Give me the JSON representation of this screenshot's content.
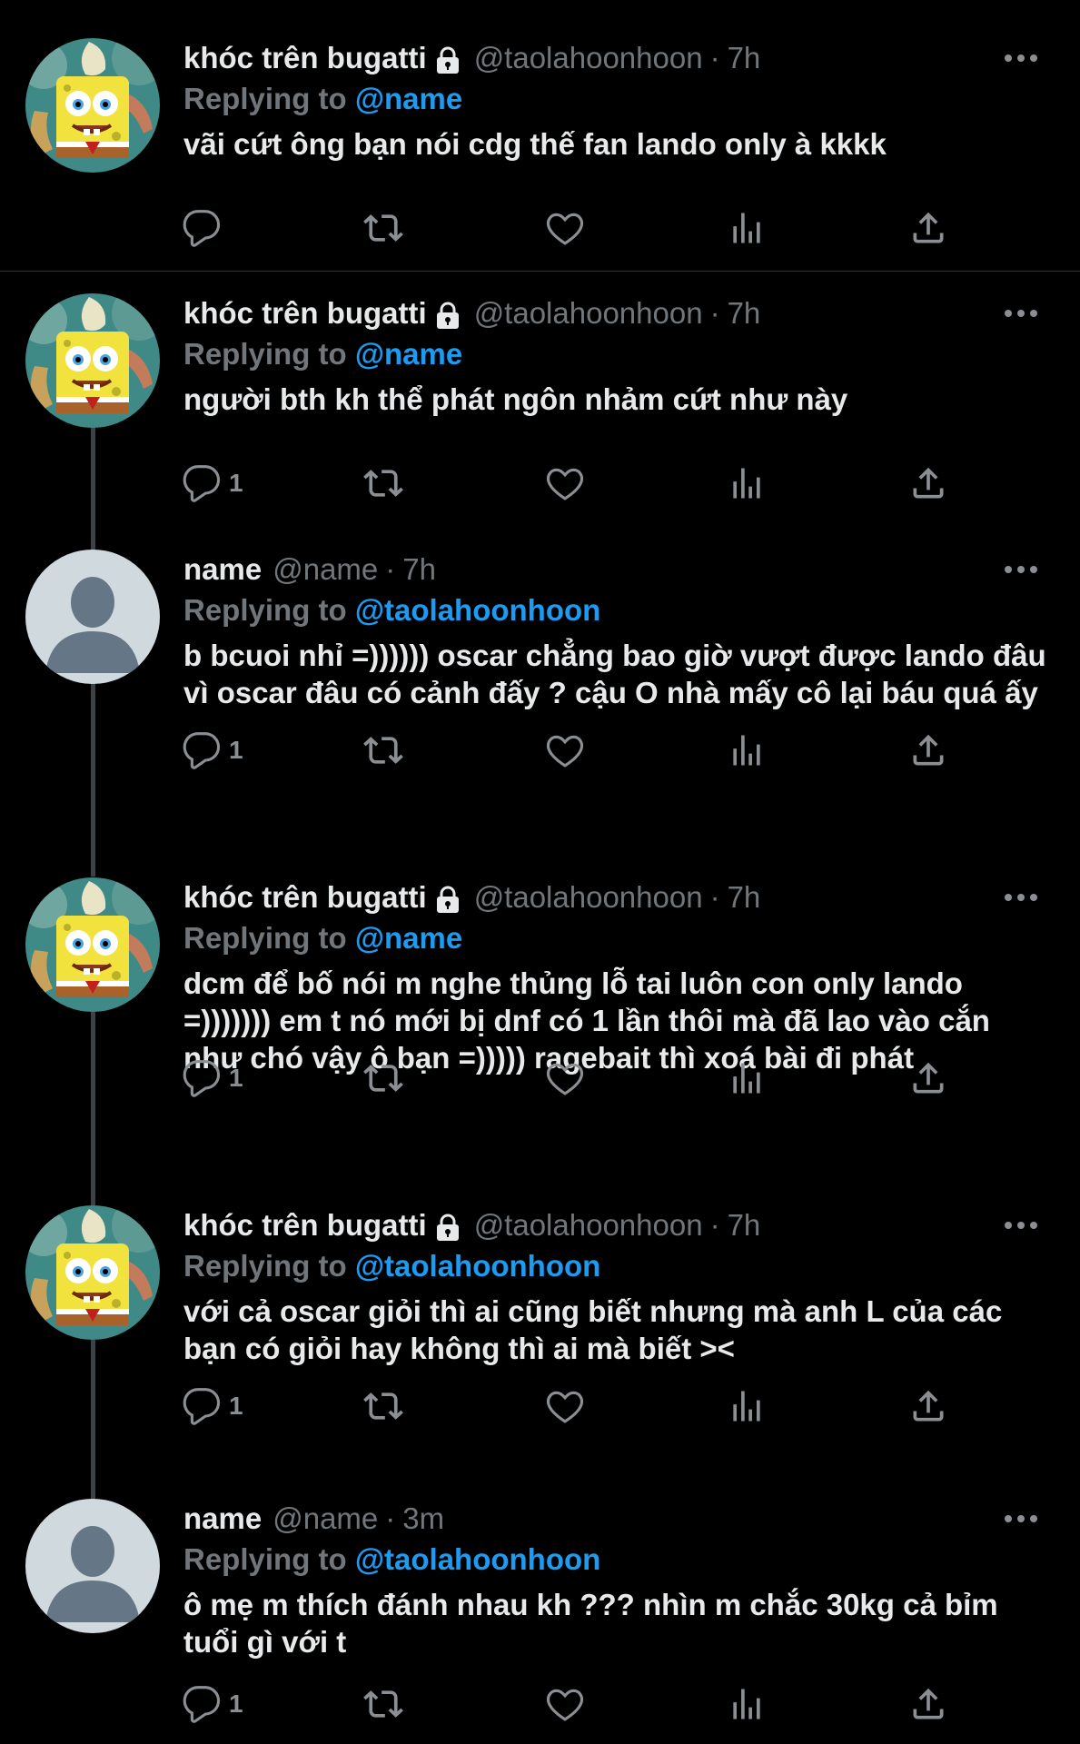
{
  "colors": {
    "background": "#000000",
    "text": "#e7e9ea",
    "muted": "#71767b",
    "mention": "#1d9bf0"
  },
  "replying_label": "Replying to",
  "tweets": [
    {
      "author": "khóc trên bugatti",
      "locked": true,
      "avatar": "spongebob-avatar",
      "handle": "@taolahoonhoon",
      "sep": "·",
      "time": "7h",
      "reply_to": "@name",
      "text": "vãi cứt ông bạn nói cdg thế fan lando only à kkkk",
      "reply_count": ""
    },
    {
      "author": "khóc trên bugatti",
      "locked": true,
      "avatar": "spongebob-avatar",
      "handle": "@taolahoonhoon",
      "sep": "·",
      "time": "7h",
      "reply_to": "@name",
      "text": "người bth kh thể phát ngôn nhảm cứt như này",
      "reply_count": "1"
    },
    {
      "author": "name",
      "locked": false,
      "avatar": "default-avatar",
      "handle": "@name",
      "sep": "·",
      "time": "7h",
      "reply_to": "@taolahoonhoon",
      "text": "b bcuoi nhỉ =)))))) oscar chẳng bao giờ vượt được lando đâu vì oscar đâu có cảnh đấy ? cậu O nhà mấy cô lại báu quá ấy",
      "reply_count": "1"
    },
    {
      "author": "khóc trên bugatti",
      "locked": true,
      "avatar": "spongebob-avatar",
      "handle": "@taolahoonhoon",
      "sep": "·",
      "time": "7h",
      "reply_to": "@name",
      "text": "dcm để bố nói m nghe thủng lỗ tai luôn con only lando =))))))) em t nó mới bị dnf có 1 lần thôi mà đã lao vào cắn như chó vậy ô bạn =))))) ragebait thì xoá bài đi phát",
      "reply_count": "1"
    },
    {
      "author": "khóc trên bugatti",
      "locked": true,
      "avatar": "spongebob-avatar",
      "handle": "@taolahoonhoon",
      "sep": "·",
      "time": "7h",
      "reply_to": "@taolahoonhoon",
      "text": "với cả oscar giỏi thì ai cũng biết nhưng mà anh L của các bạn có giỏi hay không thì ai mà biết ><",
      "reply_count": "1"
    },
    {
      "author": "name",
      "locked": false,
      "avatar": "default-avatar",
      "handle": "@name",
      "sep": "·",
      "time": "3m",
      "reply_to": "@taolahoonhoon",
      "text": "ô mẹ m thích đánh nhau kh ??? nhìn m chắc 30kg cả bỉm tuổi gì với t",
      "reply_count": "1"
    }
  ]
}
